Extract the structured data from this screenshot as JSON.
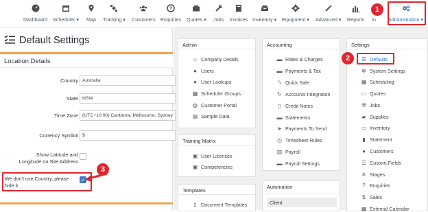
{
  "nav": {
    "items": [
      {
        "label": "Dashboard",
        "icon": "dashboard-icon"
      },
      {
        "label": "Scheduler",
        "icon": "calendar-icon",
        "caret": true
      },
      {
        "label": "Map",
        "icon": "map-pin-icon"
      },
      {
        "label": "Tracking",
        "icon": "satellite-icon",
        "caret": true
      },
      {
        "label": "Customers",
        "icon": "users-icon"
      },
      {
        "label": "Enquiries",
        "icon": "question-icon"
      },
      {
        "label": "Quotes",
        "icon": "briefcase-icon",
        "caret": true
      },
      {
        "label": "Jobs",
        "icon": "wrench-icon"
      },
      {
        "label": "Invoices",
        "icon": "book-icon"
      },
      {
        "label": "Inventory",
        "icon": "inbox-icon",
        "caret": true
      },
      {
        "label": "Equipment",
        "icon": "gear-icon",
        "caret": true
      },
      {
        "label": "Advanced",
        "icon": "magic-wand-icon",
        "caret": true
      },
      {
        "label": "Reports",
        "icon": "bar-chart-icon"
      },
      {
        "label": "In",
        "icon": "info-icon"
      },
      {
        "label": "Administration",
        "icon": "gears-icon",
        "caret": true
      }
    ],
    "accent": "#2a72c8"
  },
  "badges": {
    "one": "1",
    "two": "2",
    "three": "3"
  },
  "page": {
    "title": "Default Settings",
    "section": "Location Details"
  },
  "form": {
    "country_label": "Country",
    "country_value": "Australia",
    "state_label": "State",
    "state_value": "NSW",
    "timezone_label": "Time Zone",
    "timezone_value": "(UTC+10:00) Canberra, Melbourne, Sydney",
    "currency_label": "Currency Symbol",
    "currency_value": "$",
    "latlong_label_1": "Show Latitude and",
    "latlong_label_2": "Longitude on Site Address",
    "latlong_checked": false,
    "nocountry_label_1": "We don't use Country, please",
    "nocountry_label_2": "hide it",
    "nocountry_checked": true
  },
  "admin": {
    "title": "Admin",
    "items": [
      {
        "label": "Company Details",
        "icon": "home-icon"
      },
      {
        "label": "Users",
        "icon": "user-icon"
      },
      {
        "label": "User Lookups",
        "icon": "user-plus-icon"
      },
      {
        "label": "Scheduler Groups",
        "icon": "grid-icon"
      },
      {
        "label": "Customer Portal",
        "icon": "globe-icon"
      },
      {
        "label": "Sample Data",
        "icon": "database-icon"
      }
    ]
  },
  "training": {
    "title": "Training Matrix",
    "items": [
      {
        "label": "User Licences",
        "icon": "id-card-icon"
      },
      {
        "label": "Competencies",
        "icon": "id-card-icon"
      }
    ]
  },
  "templates": {
    "title": "Templates",
    "items": [
      {
        "label": "Document Templates",
        "icon": "file-icon"
      }
    ]
  },
  "accounting": {
    "title": "Accounting",
    "items": [
      {
        "label": "Rates & Charges",
        "icon": "money-icon"
      },
      {
        "label": "Payments & Tax",
        "icon": "money-icon"
      },
      {
        "label": "Quick Sale",
        "icon": "bolt-icon"
      },
      {
        "label": "Accounts Integration",
        "icon": "refresh-icon"
      },
      {
        "label": "Credit Notes",
        "icon": "file-icon"
      },
      {
        "label": "Statements",
        "icon": "money-icon"
      },
      {
        "label": "Payments To Send",
        "icon": "send-icon"
      },
      {
        "label": "Timesheet Rules",
        "icon": "clock-icon"
      },
      {
        "label": "Payroll",
        "icon": "building-icon"
      },
      {
        "label": "Payroll Settings",
        "icon": "money-icon"
      }
    ]
  },
  "automation": {
    "title": "Automation",
    "items": [
      {
        "label": "Client"
      }
    ]
  },
  "settings": {
    "title": "Settings",
    "items": [
      {
        "label": "Defaults",
        "icon": "list-icon"
      },
      {
        "label": "System Settings",
        "icon": "gear-icon"
      },
      {
        "label": "Scheduling",
        "icon": "calendar-icon"
      },
      {
        "label": "Quotes",
        "icon": "briefcase-icon"
      },
      {
        "label": "Jobs",
        "icon": "wrench-icon"
      },
      {
        "label": "Supplies",
        "icon": "truck-icon"
      },
      {
        "label": "Inventory",
        "icon": "inbox-icon"
      },
      {
        "label": "Statement",
        "icon": "book-icon"
      },
      {
        "label": "Customers",
        "icon": "users-icon"
      },
      {
        "label": "Custom Fields",
        "icon": "list-icon"
      },
      {
        "label": "Stages",
        "icon": "flow-icon"
      },
      {
        "label": "Enquiries",
        "icon": "question-icon"
      },
      {
        "label": "Sales",
        "icon": "dollar-icon"
      },
      {
        "label": "External Calendar",
        "icon": "calendar-icon"
      }
    ]
  }
}
